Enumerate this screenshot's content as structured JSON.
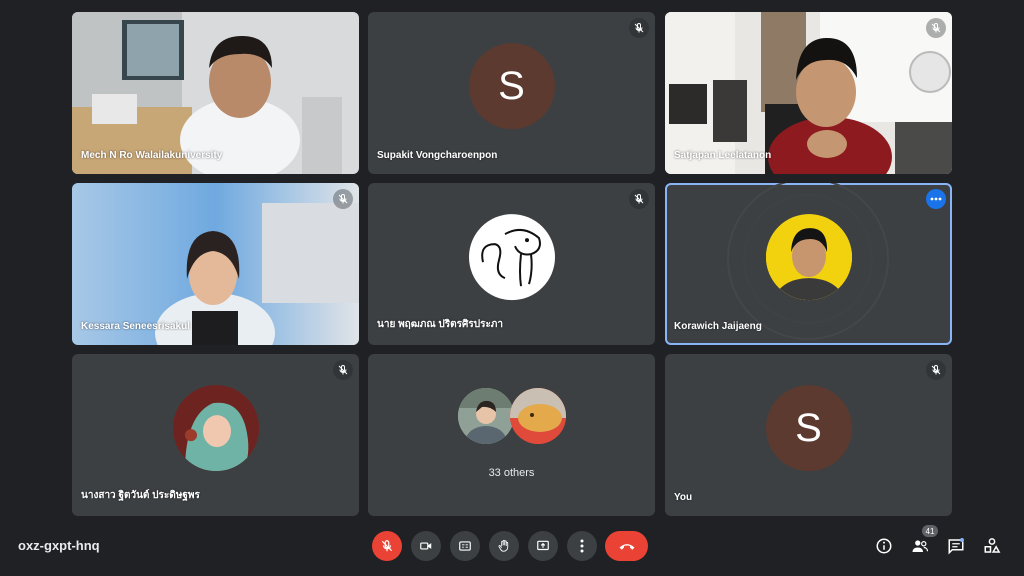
{
  "meeting": {
    "code": "oxz-gxpt-hnq"
  },
  "participants": [
    {
      "name": "Mech N Ro Walailakuniversity"
    },
    {
      "name": "Supakit Vongcharoenpon",
      "initial": "S"
    },
    {
      "name": "Satjapan Leelatanon"
    },
    {
      "name": "Kessara Seneesrisakul"
    },
    {
      "name": "นาย พฤฒภณ ปริตรศิรประภา"
    },
    {
      "name": "Korawich Jaijaeng"
    },
    {
      "name": "นางสาว ฐิตวันต์ ประดิษฐพร"
    },
    {
      "others_label": "33 others"
    },
    {
      "name": "You",
      "initial": "S"
    }
  ],
  "people_count": "41",
  "colors": {
    "background": "#202124",
    "tile": "#3c4043",
    "accent": "#8ab4f8",
    "danger": "#ea4335",
    "avatar_brown": "#5d3a30"
  },
  "icons": [
    "mic-off-icon",
    "camera-icon",
    "captions-icon",
    "raise-hand-icon",
    "present-icon",
    "more-vert-icon",
    "call-end-icon",
    "info-icon",
    "people-icon",
    "chat-icon",
    "activities-icon"
  ]
}
